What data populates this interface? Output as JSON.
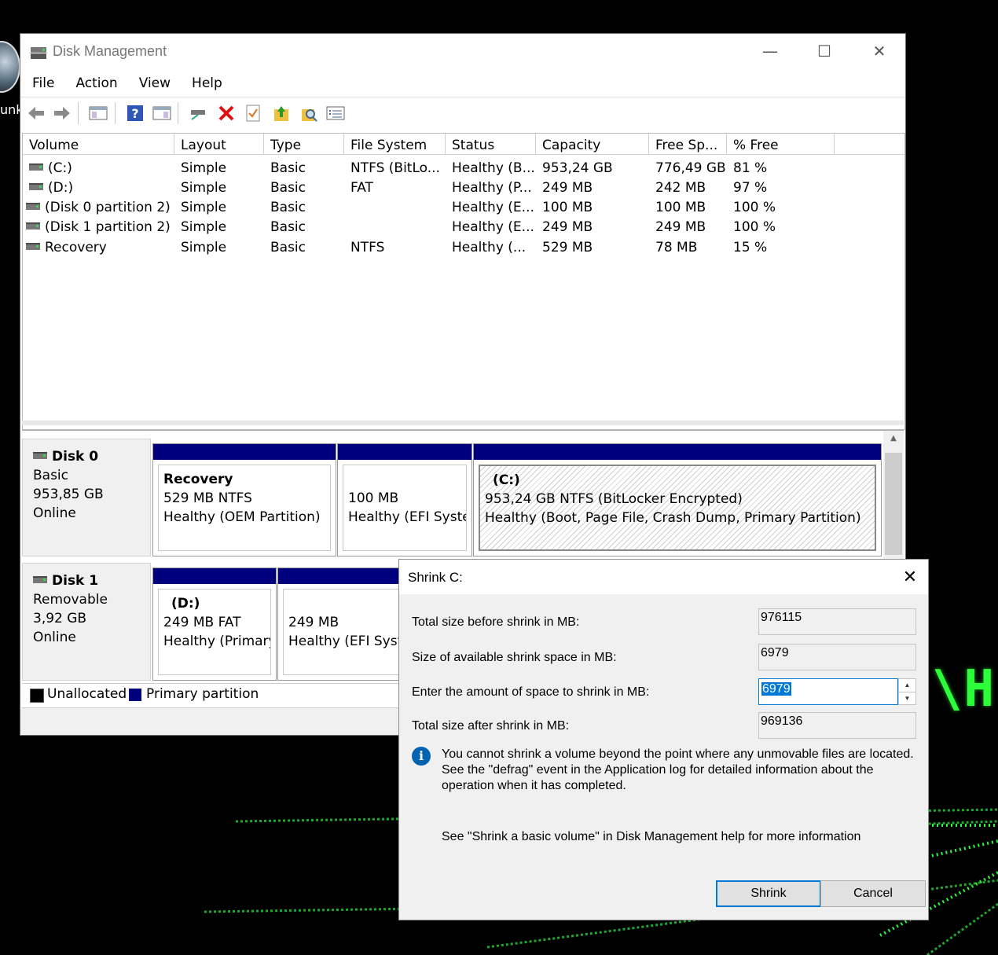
{
  "desktop": {
    "icon_label": "unk",
    "wallpaper_text": "\\H"
  },
  "window": {
    "title": "Disk Management",
    "controls": {
      "minimize": "—",
      "maximize": "☐",
      "close": "✕"
    }
  },
  "menu": [
    "File",
    "Action",
    "View",
    "Help"
  ],
  "toolbar": {
    "icons": [
      "back-arrow-icon",
      "forward-arrow-icon",
      "console-tree-icon",
      "help-icon",
      "action-pane-icon",
      "connect-disk-icon",
      "delete-icon",
      "properties-icon",
      "export-list-icon",
      "search-icon",
      "settings-list-icon"
    ]
  },
  "volume_list": {
    "columns": [
      "Volume",
      "Layout",
      "Type",
      "File System",
      "Status",
      "Capacity",
      "Free Sp...",
      "% Free"
    ],
    "rows": [
      [
        "(C:)",
        "Simple",
        "Basic",
        "NTFS (BitLo...",
        "Healthy (B...",
        "953,24 GB",
        "776,49 GB",
        "81 %"
      ],
      [
        "(D:)",
        "Simple",
        "Basic",
        "FAT",
        "Healthy (P...",
        "249 MB",
        "242 MB",
        "97 %"
      ],
      [
        "(Disk 0 partition 2)",
        "Simple",
        "Basic",
        "",
        "Healthy (E...",
        "100 MB",
        "100 MB",
        "100 %"
      ],
      [
        "(Disk 1 partition 2)",
        "Simple",
        "Basic",
        "",
        "Healthy (E...",
        "249 MB",
        "249 MB",
        "100 %"
      ],
      [
        "Recovery",
        "Simple",
        "Basic",
        "NTFS",
        "Healthy (...",
        "529 MB",
        "78 MB",
        "15 %"
      ]
    ]
  },
  "disks": [
    {
      "name": "Disk 0",
      "type": "Basic",
      "size": "953,85 GB",
      "state": "Online",
      "partitions": [
        {
          "name": "Recovery",
          "size": "529 MB NTFS",
          "status": "Healthy (OEM Partition)"
        },
        {
          "name": "",
          "size": "100 MB",
          "status": "Healthy (EFI Syster"
        },
        {
          "name": "(C:)",
          "size": "953,24 GB NTFS (BitLocker Encrypted)",
          "status": "Healthy (Boot, Page File, Crash Dump, Primary Partition)"
        }
      ]
    },
    {
      "name": "Disk 1",
      "type": "Removable",
      "size": "3,92 GB",
      "state": "Online",
      "partitions": [
        {
          "name": "(D:)",
          "size": "249 MB FAT",
          "status": "Healthy (Primary"
        },
        {
          "name": "",
          "size": "249 MB",
          "status": "Healthy (EFI Syste"
        }
      ]
    }
  ],
  "legend": {
    "unallocated": "Unallocated",
    "unallocated_color": "#000000",
    "primary": "Primary partition",
    "primary_color": "#00007f"
  },
  "dialog": {
    "title": "Shrink C:",
    "total_before_label": "Total size before shrink in MB:",
    "total_before_value": "976115",
    "available_label": "Size of available shrink space in MB:",
    "available_value": "6979",
    "amount_label": "Enter the amount of space to shrink in MB:",
    "amount_value": "6979",
    "total_after_label": "Total size after shrink in MB:",
    "total_after_value": "969136",
    "info_text": "You cannot shrink a volume beyond the point where any unmovable files are located. See the \"defrag\" event in the Application log for detailed information about the operation when it has completed.",
    "help_text": "See \"Shrink a basic volume\" in Disk Management help for more information",
    "shrink_button": "Shrink",
    "cancel_button": "Cancel"
  }
}
